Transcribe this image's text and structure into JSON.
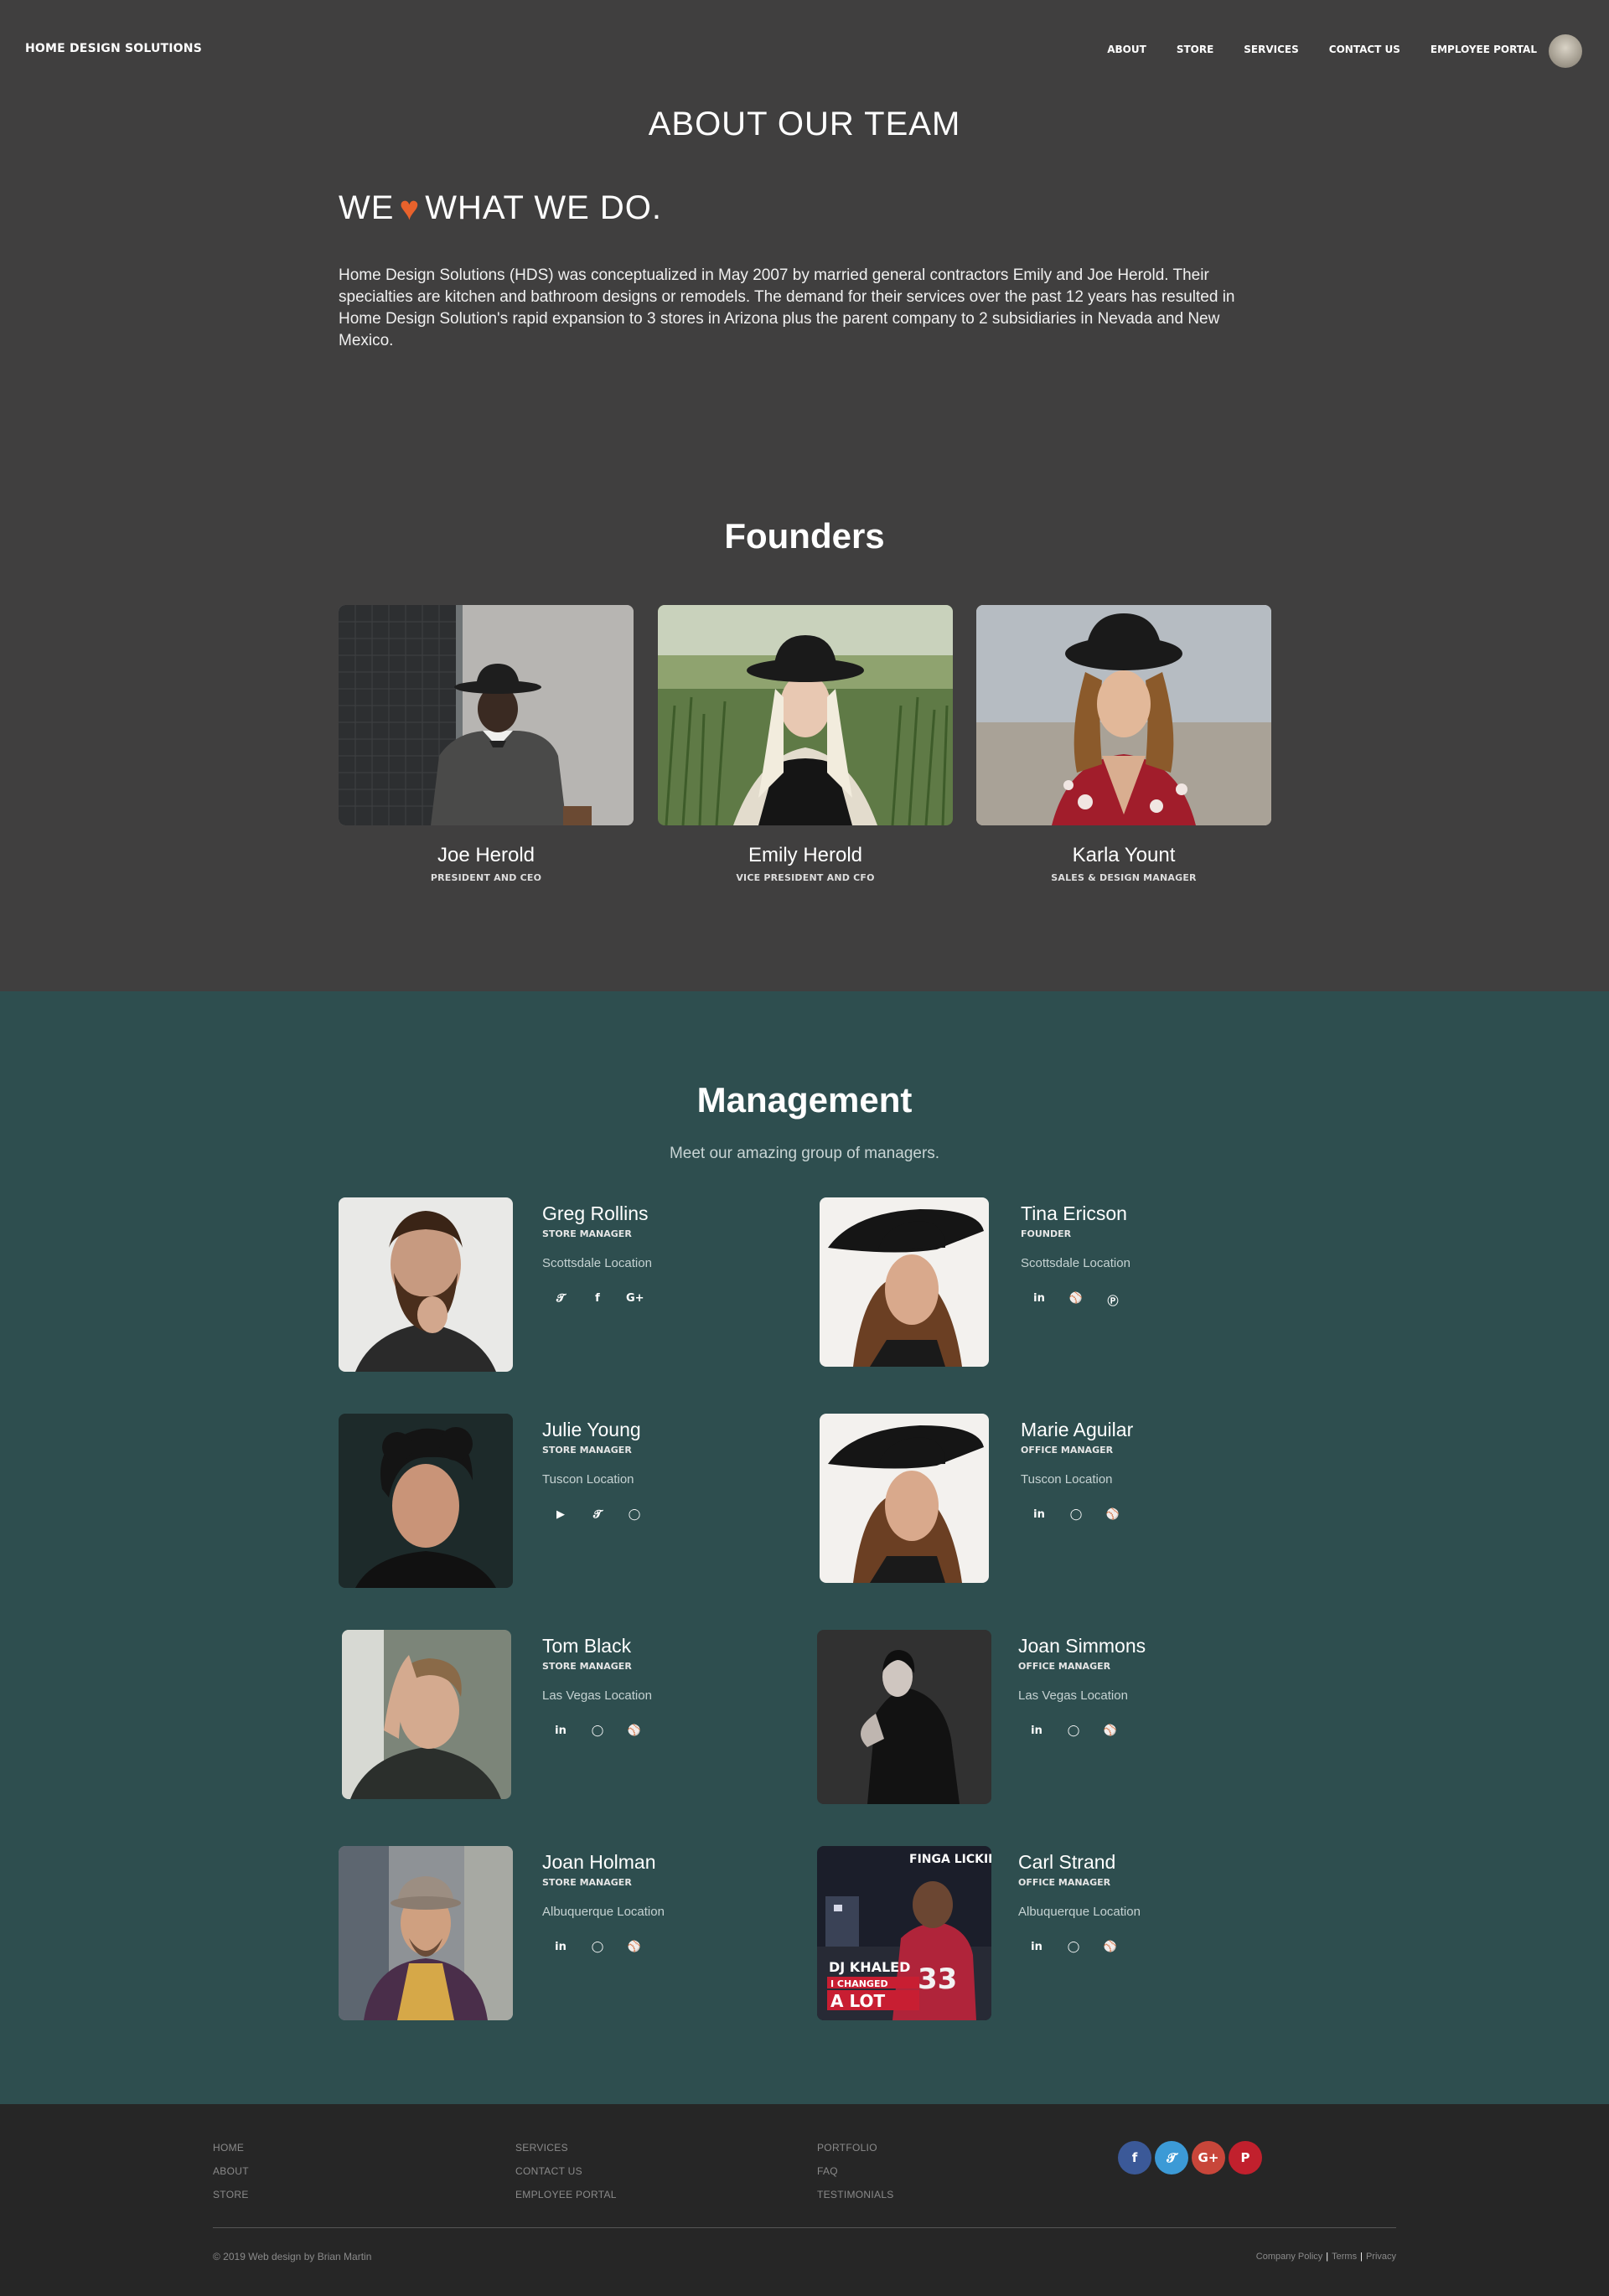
{
  "brand": "HOME DESIGN SOLUTIONS",
  "nav": [
    "ABOUT",
    "STORE",
    "SERVICES",
    "CONTACT US",
    "EMPLOYEE PORTAL"
  ],
  "about": {
    "title": "ABOUT OUR TEAM",
    "tagline_before": "WE",
    "tagline_after": "WHAT WE DO.",
    "heart_icon": "heart-icon",
    "heart_color": "#e8622c",
    "intro": "Home Design Solutions (HDS) was conceptualized in May 2007 by married general contractors Emily and Joe Herold. Their specialties are kitchen and bathroom designs or remodels. The demand for their services over the past 12 years has resulted in Home Design Solution's rapid expansion to 3 stores in Arizona plus the parent company to 2 subsidiaries in Nevada and New Mexico."
  },
  "founders": {
    "title": "Founders",
    "people": [
      {
        "name": "Joe Herold",
        "role": "PRESIDENT AND CEO"
      },
      {
        "name": "Emily Herold",
        "role": "VICE PRESIDENT AND CFO"
      },
      {
        "name": "Karla Yount",
        "role": "SALES & DESIGN MANAGER"
      }
    ]
  },
  "management": {
    "title": "Management",
    "subtitle": "Meet our amazing group of managers.",
    "people": [
      {
        "name": "Greg Rollins",
        "role": "STORE MANAGER",
        "location": "Scottsdale Location",
        "socials": [
          "twitter-icon",
          "facebook-icon",
          "google-plus-icon"
        ]
      },
      {
        "name": "Tina Ericson",
        "role": "FOUNDER",
        "location": "Scottsdale Location",
        "socials": [
          "linkedin-icon",
          "dribbble-icon",
          "pinterest-icon"
        ]
      },
      {
        "name": "Julie Young",
        "role": "STORE MANAGER",
        "location": "Tuscon Location",
        "socials": [
          "youtube-icon",
          "twitter-icon",
          "instagram-icon"
        ]
      },
      {
        "name": "Marie Aguilar",
        "role": "OFFICE MANAGER",
        "location": "Tuscon Location",
        "socials": [
          "linkedin-icon",
          "instagram-icon",
          "dribbble-icon"
        ]
      },
      {
        "name": "Tom Black",
        "role": "STORE MANAGER",
        "location": "Las Vegas Location",
        "socials": [
          "linkedin-icon",
          "instagram-icon",
          "dribbble-icon"
        ]
      },
      {
        "name": "Joan Simmons",
        "role": "OFFICE MANAGER",
        "location": "Las Vegas Location",
        "socials": [
          "linkedin-icon",
          "instagram-icon",
          "dribbble-icon"
        ]
      },
      {
        "name": "Joan Holman",
        "role": "STORE MANAGER",
        "location": "Albuquerque Location",
        "socials": [
          "linkedin-icon",
          "instagram-icon",
          "dribbble-icon"
        ]
      },
      {
        "name": "Carl Strand",
        "role": "OFFICE MANAGER",
        "location": "Albuquerque Location",
        "socials": [
          "linkedin-icon",
          "instagram-icon",
          "dribbble-icon"
        ]
      }
    ],
    "album_text": {
      "top": "FINGA LICKING",
      "artist": "DJ KHALED",
      "line1": "I CHANGED",
      "line2": "A LOT",
      "jersey": "33"
    }
  },
  "footer": {
    "col1": [
      "HOME",
      "ABOUT",
      "STORE"
    ],
    "col2": [
      "SERVICES",
      "CONTACT US",
      "EMPLOYEE PORTAL"
    ],
    "col3": [
      "PORTFOLIO",
      "FAQ",
      "TESTIMONIALS"
    ],
    "socials": [
      {
        "icon": "facebook-icon",
        "color": "#3b5998"
      },
      {
        "icon": "twitter-icon",
        "color": "#3c9ad6"
      },
      {
        "icon": "google-plus-icon",
        "color": "#c8463a"
      },
      {
        "icon": "pinterest-icon",
        "color": "#c1202d"
      }
    ],
    "copyright": "© 2019 Web design by Brian Martin",
    "legal": [
      "Company Policy",
      "Terms",
      "Privacy"
    ]
  }
}
